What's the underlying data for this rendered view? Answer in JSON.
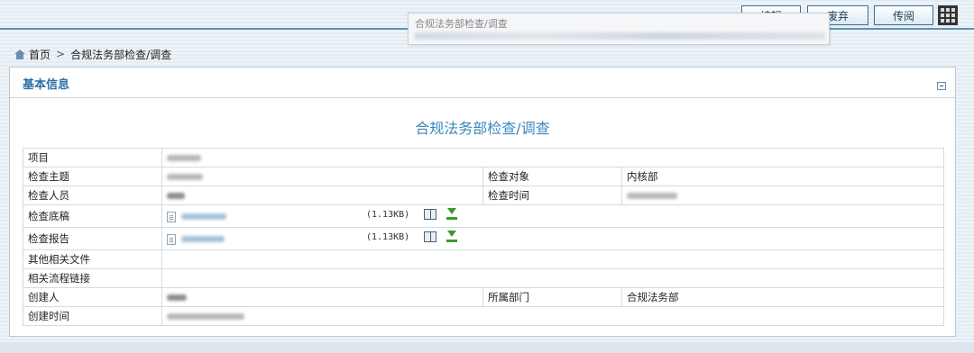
{
  "toolbar": {
    "edit_label": "编辑",
    "discard_label": "废弃",
    "forward_label": "传阅",
    "grid_icon": "grid-menu-icon"
  },
  "tooltip": {
    "title": "合规法务部检查/调查"
  },
  "breadcrumb": {
    "home": "首页",
    "separator": ">",
    "current": "合规法务部检查/调查"
  },
  "panel": {
    "title": "基本信息",
    "form_title": "合规法务部检查/调查"
  },
  "fields": {
    "project": {
      "label": "项目"
    },
    "subject": {
      "label": "检查主题"
    },
    "target": {
      "label": "检查对象",
      "value": "内核部"
    },
    "inspector": {
      "label": "检查人员"
    },
    "check_time": {
      "label": "检查时间"
    },
    "draft": {
      "label": "检查底稿",
      "size": "(1.13KB)"
    },
    "report": {
      "label": "检查报告",
      "size": "(1.13KB)"
    },
    "other_files": {
      "label": "其他相关文件"
    },
    "flow_links": {
      "label": "相关流程链接"
    },
    "creator": {
      "label": "创建人"
    },
    "department": {
      "label": "所属部门",
      "value": "合规法务部"
    },
    "created_time": {
      "label": "创建时间"
    }
  },
  "colors": {
    "accent": "#2a6fa6",
    "title_blue": "#3a88c0",
    "border": "#d3dbe2",
    "download_green": "#3d9a2e"
  }
}
